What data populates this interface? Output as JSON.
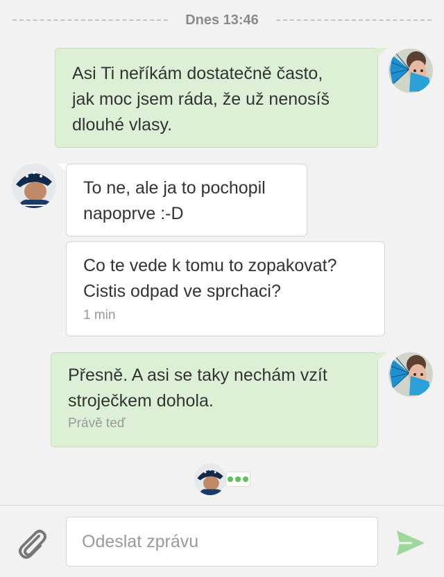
{
  "divider": {
    "label": "Dnes 13:46"
  },
  "messages": [
    {
      "sender": "me",
      "text": "Asi Ti neříkám dostatečně často,\njak moc jsem ráda, že už nenosíš\ndlouhé vlasy."
    },
    {
      "sender": "them",
      "text": "To ne, ale ja to pochopil\nnapoprve :-D"
    },
    {
      "sender": "them",
      "text": "Co te vede k tomu to zopakovat?\nCistis odpad ve sprchaci?",
      "time": "1 min"
    },
    {
      "sender": "me",
      "text": "Přesně. A asi se taky nechám vzít\nstroječkem dohola.",
      "time": "Právě teď"
    }
  ],
  "composer": {
    "placeholder": "Odeslat zprávu",
    "attach_icon": "paperclip-icon",
    "send_icon": "send-icon"
  },
  "colors": {
    "outgoing_bubble": "#dcf0d6",
    "incoming_bubble": "#ffffff",
    "accent": "#5cc35c",
    "background": "#f2f2f2"
  }
}
